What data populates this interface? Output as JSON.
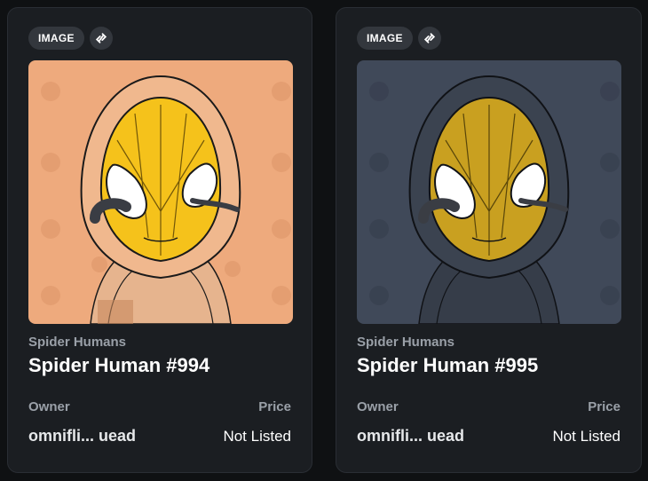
{
  "cards": [
    {
      "badge_label": "IMAGE",
      "badge_icon": "link-icon",
      "collection": "Spider Humans",
      "title": "Spider Human #994",
      "owner_label": "Owner",
      "owner_value": "omnifli... uead",
      "price_label": "Price",
      "price_value": "Not Listed",
      "art_background": "#eeaa7d"
    },
    {
      "badge_label": "IMAGE",
      "badge_icon": "link-icon",
      "collection": "Spider Humans",
      "title": "Spider Human #995",
      "owner_label": "Owner",
      "owner_value": "omnifli... uead",
      "price_label": "Price",
      "price_value": "Not Listed",
      "art_background": "#404959"
    }
  ]
}
